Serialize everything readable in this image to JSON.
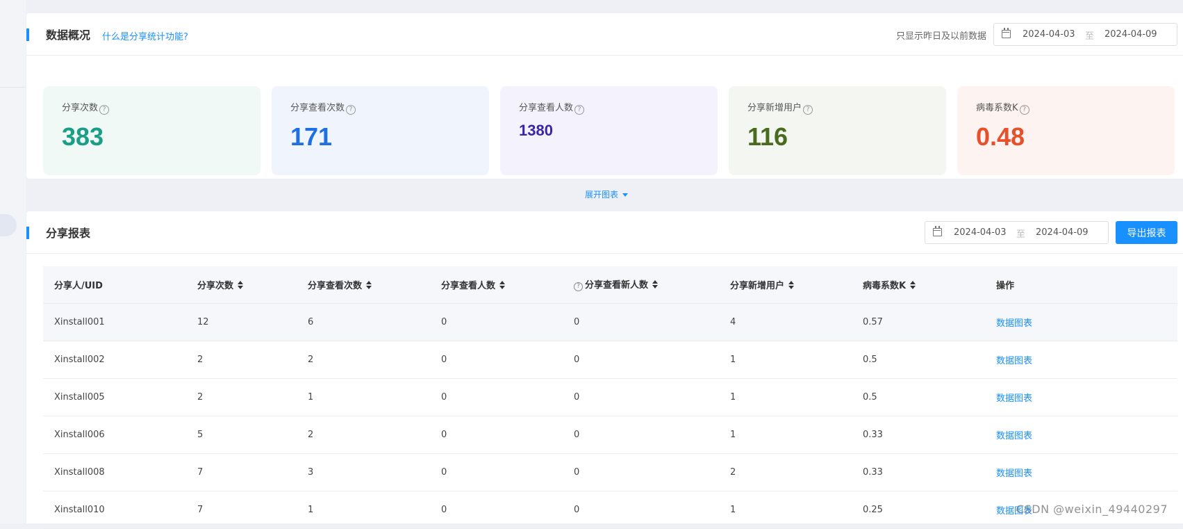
{
  "overview": {
    "title": "数据概况",
    "help_link": "什么是分享统计功能?",
    "note": "只显示昨日及以前数据",
    "date_start": "2024-04-03",
    "date_sep": "至",
    "date_end": "2024-04-09",
    "stats": [
      {
        "label": "分享次数",
        "value": "383",
        "color": "#1a9e85",
        "bg": "#f1f9f7"
      },
      {
        "label": "分享查看次数",
        "value": "171",
        "color": "#1e6fe0",
        "bg": "#f0f5fd"
      },
      {
        "label": "分享查看人数",
        "value": "1380",
        "color": "#3a25a8",
        "bg": "#f4f2fd"
      },
      {
        "label": "分享新增用户",
        "value": "116",
        "color": "#4a6b1f",
        "bg": "#f4f6f1"
      },
      {
        "label": "病毒系数K",
        "value": "0.48",
        "color": "#e6502a",
        "bg": "#fdf3f1"
      }
    ],
    "help_glyph": "?"
  },
  "expand_label": "展开图表",
  "report": {
    "title": "分享报表",
    "date_start": "2024-04-03",
    "date_sep": "至",
    "date_end": "2024-04-09",
    "export_label": "导出报表",
    "columns": [
      "分享人/UID",
      "分享次数",
      "分享查看次数",
      "分享查看人数",
      "分享查看新人数",
      "分享新增用户",
      "病毒系数K",
      "操作"
    ],
    "rows": [
      [
        "Xinstall001",
        "12",
        "6",
        "0",
        "0",
        "4",
        "0.57",
        "数据图表"
      ],
      [
        "Xinstall002",
        "2",
        "2",
        "0",
        "0",
        "1",
        "0.5",
        "数据图表"
      ],
      [
        "Xinstall005",
        "2",
        "1",
        "0",
        "0",
        "1",
        "0.5",
        "数据图表"
      ],
      [
        "Xinstall006",
        "5",
        "2",
        "0",
        "0",
        "1",
        "0.33",
        "数据图表"
      ],
      [
        "Xinstall008",
        "7",
        "3",
        "0",
        "0",
        "2",
        "0.33",
        "数据图表"
      ],
      [
        "Xinstall010",
        "7",
        "1",
        "0",
        "0",
        "1",
        "0.25",
        "数据图表"
      ]
    ]
  },
  "watermark": "CSDN @weixin_49440297"
}
